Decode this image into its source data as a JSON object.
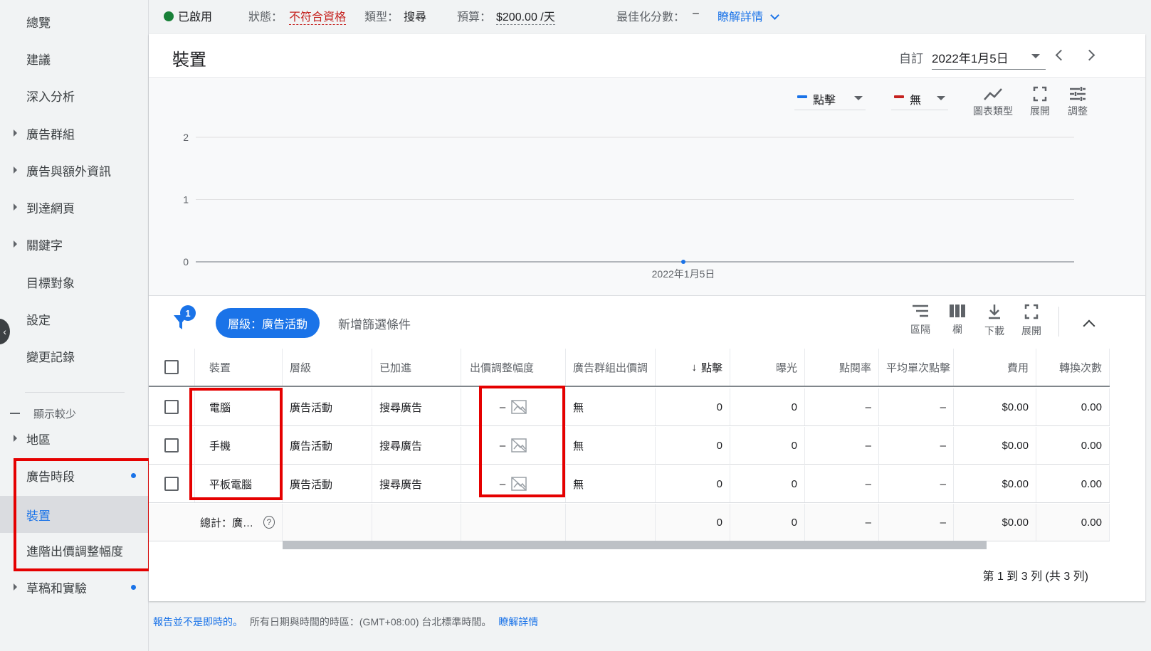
{
  "sidebar": {
    "items": [
      {
        "label": "總覽"
      },
      {
        "label": "建議"
      },
      {
        "label": "深入分析"
      },
      {
        "label": "廣告群組"
      },
      {
        "label": "廣告與額外資訊"
      },
      {
        "label": "到達網頁"
      },
      {
        "label": "關鍵字"
      },
      {
        "label": "目標對象"
      },
      {
        "label": "設定"
      },
      {
        "label": "變更記錄"
      }
    ],
    "show_less": "顯示較少",
    "sub_items": [
      {
        "label": "地區"
      },
      {
        "label": "廣告時段"
      },
      {
        "label": "裝置"
      },
      {
        "label": "進階出價調整幅度"
      },
      {
        "label": "草稿和實驗"
      }
    ]
  },
  "status_bar": {
    "enabled": "已啟用",
    "status_label": "狀態：",
    "status_value": "不符合資格",
    "type_label": "類型：",
    "type_value": "搜尋",
    "budget_label": "預算：",
    "budget_value": "$200.00 /天",
    "score_label": "最佳化分數：",
    "score_value": "–",
    "learn_more": "瞭解詳情"
  },
  "header": {
    "title": "裝置",
    "date_mode": "自訂",
    "date_value": "2022年1月5日"
  },
  "chart_controls": {
    "metric1": "點擊",
    "metric2": "無",
    "tools": [
      {
        "label": "圖表類型"
      },
      {
        "label": "展開"
      },
      {
        "label": "調整"
      }
    ]
  },
  "chart_data": {
    "type": "line",
    "x": [
      "2022年1月5日"
    ],
    "series": [
      {
        "name": "點擊",
        "values": [
          0
        ]
      }
    ],
    "y_ticks": [
      0,
      1,
      2
    ],
    "ylim": [
      0,
      2
    ],
    "grid": true
  },
  "table_toolbar": {
    "filter_count": "1",
    "chip": "層級：廣告活動",
    "add_filter": "新增篩選條件",
    "tools": [
      {
        "label": "區隔"
      },
      {
        "label": "欄"
      },
      {
        "label": "下載"
      },
      {
        "label": "展開"
      }
    ]
  },
  "table": {
    "headers": [
      "裝置",
      "層級",
      "已加進",
      "出價調整幅度",
      "廣告群組出價調",
      "點擊",
      "曝光",
      "點閱率",
      "平均單次點擊",
      "費用",
      "轉換次數"
    ],
    "rows": [
      {
        "device": "電腦",
        "level": "廣告活動",
        "added_to": "搜尋廣告",
        "bid_adj": "–",
        "group_bid": "無",
        "clicks": "0",
        "impr": "0",
        "ctr": "–",
        "cpc": "–",
        "cost": "$0.00",
        "conv": "0.00"
      },
      {
        "device": "手機",
        "level": "廣告活動",
        "added_to": "搜尋廣告",
        "bid_adj": "–",
        "group_bid": "無",
        "clicks": "0",
        "impr": "0",
        "ctr": "–",
        "cpc": "–",
        "cost": "$0.00",
        "conv": "0.00"
      },
      {
        "device": "平板電腦",
        "level": "廣告活動",
        "added_to": "搜尋廣告",
        "bid_adj": "–",
        "group_bid": "無",
        "clicks": "0",
        "impr": "0",
        "ctr": "–",
        "cpc": "–",
        "cost": "$0.00",
        "conv": "0.00"
      }
    ],
    "total": {
      "label": "總計：廣…",
      "clicks": "0",
      "impr": "0",
      "ctr": "–",
      "cpc": "–",
      "cost": "$0.00",
      "conv": "0.00"
    },
    "pagination": "第 1 到 3 列 (共 3 列)"
  },
  "footer": {
    "not_realtime": "報告並不是即時的。",
    "timezone": "所有日期與時間的時區：(GMT+08:00) 台北標準時間。",
    "learn_more": "瞭解詳情"
  },
  "colors": {
    "accent": "#1a73e8",
    "enabled": "#188038",
    "error": "#c5221f",
    "highlight_box": "#e50000"
  }
}
